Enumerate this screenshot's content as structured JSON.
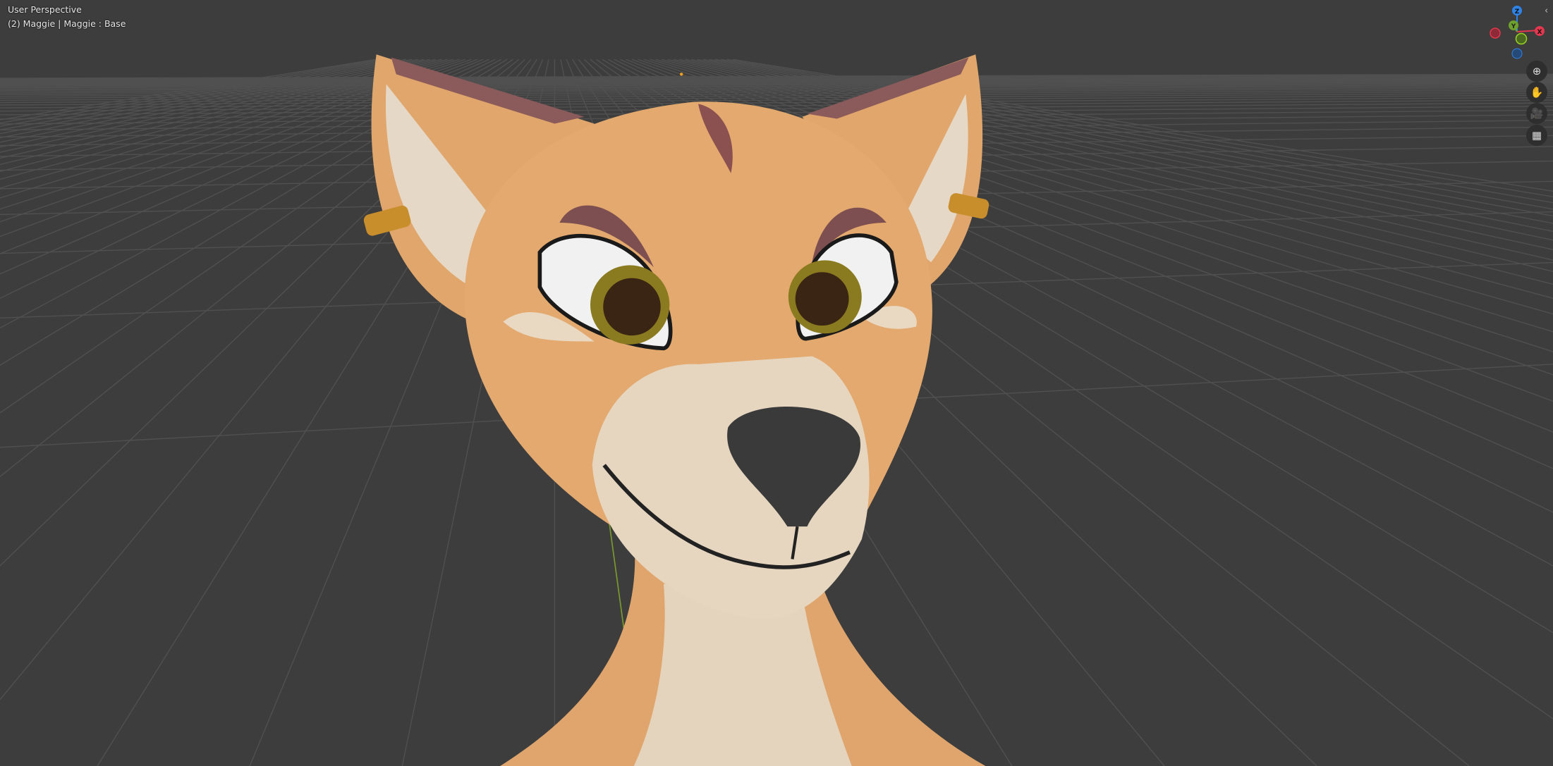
{
  "viewport": {
    "view_name": "User Perspective",
    "object_info": "(2) Maggie | Maggie : Base"
  },
  "gizmo": {
    "axes": [
      {
        "label": "Z",
        "color": "#2f83e6"
      },
      {
        "label": "Y",
        "color": "#6ea22d"
      },
      {
        "label": "X",
        "color": "#e2374e"
      }
    ]
  },
  "nav_tools": [
    {
      "name": "zoom",
      "icon": "zoom-icon"
    },
    {
      "name": "pan",
      "icon": "hand-icon"
    },
    {
      "name": "camera",
      "icon": "camera-icon"
    },
    {
      "name": "perspective",
      "icon": "grid-icon"
    }
  ],
  "colors": {
    "background": "#3d3d3d",
    "grid": "#4e4e4e",
    "fur": "#e3a96e",
    "muzzle": "#e6d6c0"
  }
}
